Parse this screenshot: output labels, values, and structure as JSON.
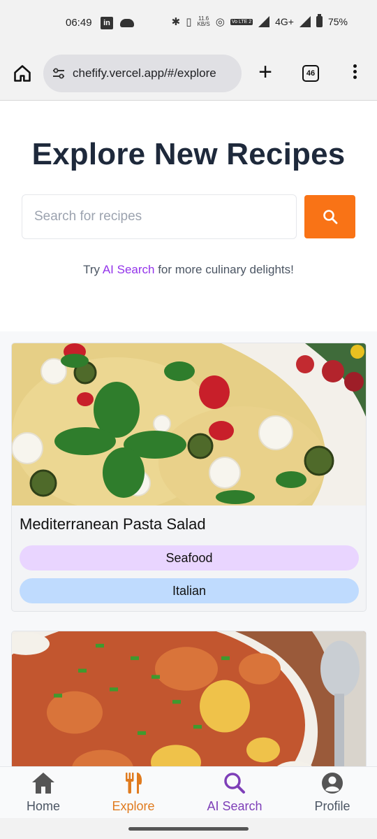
{
  "status_bar": {
    "time": "06:49",
    "linkedin_glyph": "in",
    "network_speed_value": "11.6",
    "network_speed_unit": "KB/S",
    "volte_label": "Vo LTE 2",
    "network_type": "4G+",
    "battery": "75%"
  },
  "browser": {
    "url": "chefify.vercel.app/#/explore",
    "tab_count": "46"
  },
  "hero": {
    "title": "Explore New Recipes",
    "search_placeholder": "Search for recipes",
    "tagline_prefix": "Try ",
    "tagline_link": "AI Search",
    "tagline_suffix": " for more culinary delights!"
  },
  "recipes": [
    {
      "title": "Mediterranean Pasta Salad",
      "tags": [
        "Seafood",
        "Italian"
      ]
    },
    {
      "title": "",
      "tags": []
    }
  ],
  "bottom_nav": [
    {
      "label": "Home",
      "icon": "home-icon"
    },
    {
      "label": "Explore",
      "icon": "fork-knife-icon",
      "active": true
    },
    {
      "label": "AI Search",
      "icon": "search-icon"
    },
    {
      "label": "Profile",
      "icon": "profile-icon"
    }
  ],
  "colors": {
    "accent_orange": "#f97316",
    "ai_purple": "#9333ea",
    "tag_purple": "#e9d5ff",
    "tag_blue": "#bfdbfe",
    "title_dark": "#1e293b"
  }
}
